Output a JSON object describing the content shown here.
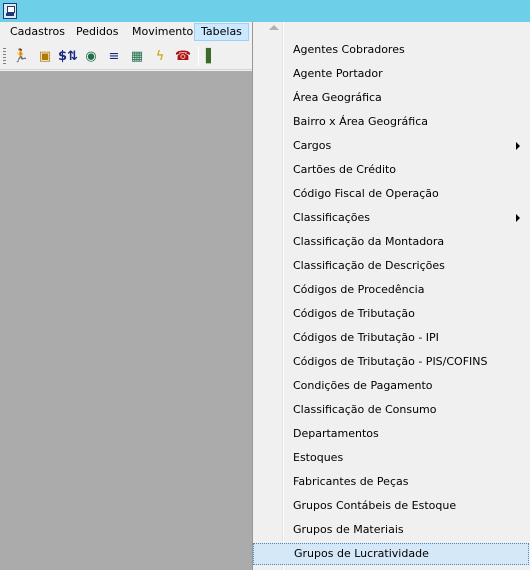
{
  "menubar": {
    "items": [
      "Cadastros",
      "Pedidos",
      "Movimento",
      "Tabelas"
    ]
  },
  "toolbar": {
    "icons": [
      "run-icon",
      "open-box-icon",
      "money-icon",
      "globe-icon",
      "align-icon",
      "calculator-icon",
      "lightning-icon",
      "telephone-icon",
      "exit-door-icon"
    ]
  },
  "tabelas_menu": {
    "items": [
      {
        "label": "Agentes Cobradores",
        "submenu": false
      },
      {
        "label": "Agente Portador",
        "submenu": false
      },
      {
        "label": "Área Geográfica",
        "submenu": false
      },
      {
        "label": "Bairro x Área Geográfica",
        "submenu": false
      },
      {
        "label": "Cargos",
        "submenu": true
      },
      {
        "label": "Cartões de Crédito",
        "submenu": false
      },
      {
        "label": "Código Fiscal de Operação",
        "submenu": false
      },
      {
        "label": "Classificações",
        "submenu": true
      },
      {
        "label": "Classificação da Montadora",
        "submenu": false
      },
      {
        "label": "Classificação de Descrições",
        "submenu": false
      },
      {
        "label": "Códigos de Procedência",
        "submenu": false
      },
      {
        "label": "Códigos de Tributação",
        "submenu": false
      },
      {
        "label": "Códigos de Tributação - IPI",
        "submenu": false
      },
      {
        "label": "Códigos de Tributação - PIS/COFINS",
        "submenu": false
      },
      {
        "label": "Condições de Pagamento",
        "submenu": false
      },
      {
        "label": "Classificação de Consumo",
        "submenu": false
      },
      {
        "label": "Departamentos",
        "submenu": false
      },
      {
        "label": "Estoques",
        "submenu": false
      },
      {
        "label": "Fabricantes de  Peças",
        "submenu": false
      },
      {
        "label": "Grupos Contábeis de Estoque",
        "submenu": false
      },
      {
        "label": "Grupos de Materiais",
        "submenu": false
      },
      {
        "label": "Grupos de Lucratividade",
        "submenu": false
      }
    ],
    "highlighted_index": 21
  },
  "colors": {
    "titlebar": "#6ecfe9",
    "workspace": "#ababab",
    "active_menu": "#cce8ff",
    "highlight": "#d5e8f8"
  }
}
